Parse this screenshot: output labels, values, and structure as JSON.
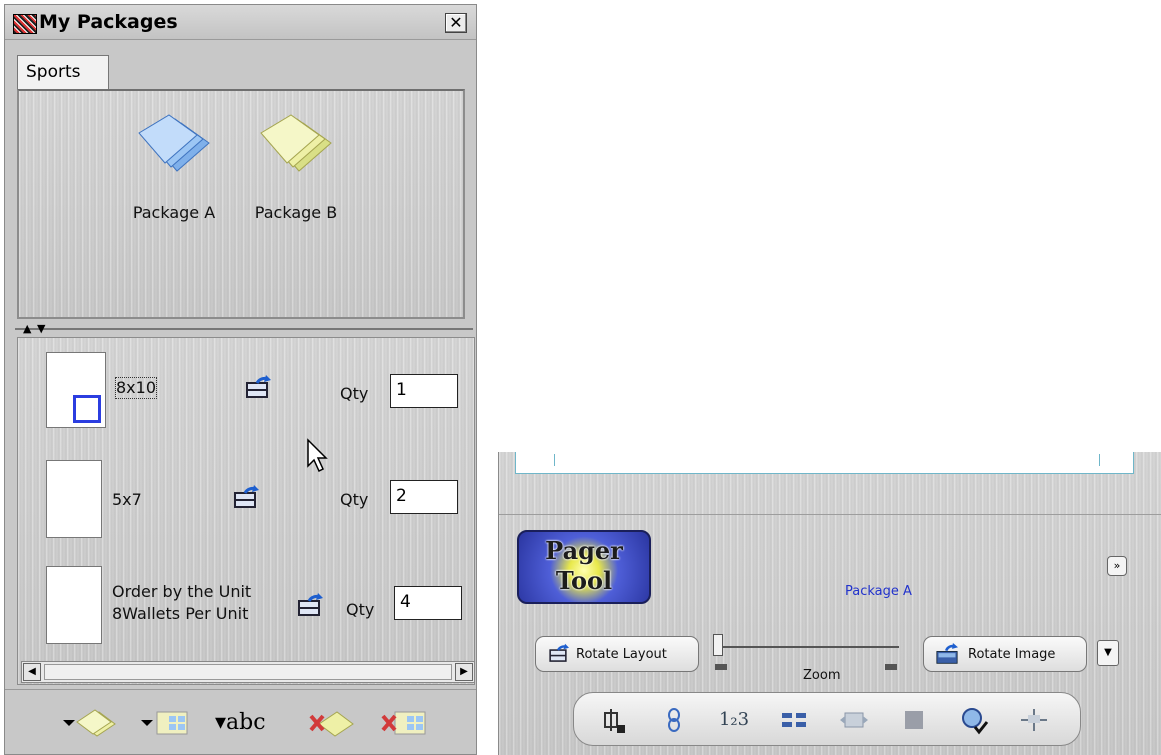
{
  "window": {
    "title": "My Packages",
    "close_symbol": "✕"
  },
  "tabs": [
    {
      "label": "Sports"
    }
  ],
  "packages": [
    {
      "label": "Package A",
      "color": "#9cc6f4"
    },
    {
      "label": "Package B",
      "color": "#eef0a6"
    }
  ],
  "items": [
    {
      "label_line1": "8x10",
      "label_line2": "",
      "qty_label": "Qty",
      "qty": "1"
    },
    {
      "label_line1": "5x7",
      "label_line2": "",
      "qty_label": "Qty",
      "qty": "2"
    },
    {
      "label_line1": "Order by the Unit",
      "label_line2": "8Wallets Per Unit",
      "qty_label": "Qty",
      "qty": "4"
    }
  ],
  "splitter": {
    "up": "▲",
    "down": "▼"
  },
  "scrollbar": {
    "left": "◀",
    "right": "▶"
  },
  "toolbar_icons": [
    "add-package-icon",
    "add-layout-icon",
    "rename-icon",
    "delete-package-icon",
    "delete-layout-icon"
  ],
  "toolbar": {
    "rename_text": "▾abc"
  },
  "pager": {
    "logo_line1": "Pager",
    "logo_line2": "Tool",
    "package_name": "Package A",
    "expand_symbol": "»",
    "rotate_layout_label": "Rotate Layout",
    "zoom_label": "Zoom",
    "rotate_image_label": "Rotate Image",
    "dropdown_symbol": "▼",
    "tools_text_numbers": "1₂3",
    "tools_icons": [
      "lock-crop-icon",
      "link-icon",
      "numbering-icon",
      "grid-icon",
      "fit-icon",
      "fill-icon",
      "refresh-check-icon",
      "guides-icon"
    ]
  },
  "colors": {
    "package_name": "#2233cc",
    "canvas_border": "#6fb6c9",
    "logo_bg": "#2a35a0"
  }
}
